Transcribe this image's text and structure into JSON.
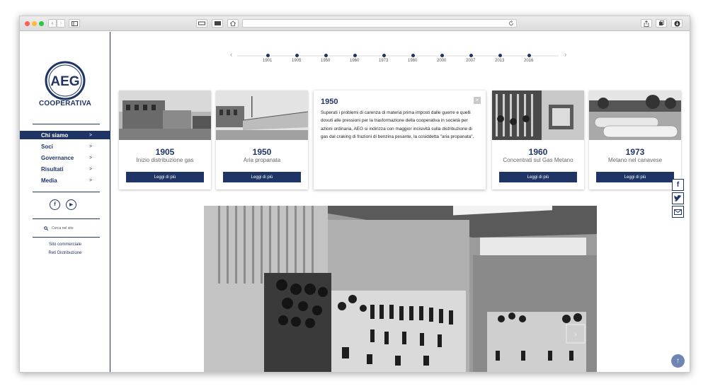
{
  "browser": {
    "back_icon": "chevron-left-icon",
    "forward_icon": "chevron-right-icon",
    "sidebar_icon": "sidebar-icon",
    "reload_icon": "reload-icon",
    "share_icon": "share-icon",
    "tabs_icon": "tabs-icon",
    "download_icon": "download-icon"
  },
  "brand": {
    "logo_text": "AEG",
    "subtitle": "COOPERATIVA",
    "color": "#1f3566"
  },
  "nav": {
    "items": [
      {
        "label": "Chi siamo",
        "chevron": ">",
        "active": true
      },
      {
        "label": "Soci",
        "chevron": ">"
      },
      {
        "label": "Governance",
        "chevron": ">"
      },
      {
        "label": "Risultati",
        "chevron": ">"
      },
      {
        "label": "Media",
        "chevron": ">"
      }
    ]
  },
  "social": {
    "facebook": "f",
    "youtube": "▶"
  },
  "search": {
    "label": "Cerca nel sito"
  },
  "links": [
    "Sito commerciale",
    "Reti Distribuzione"
  ],
  "timeline": {
    "prev": "‹",
    "next": "›",
    "years": [
      "1901",
      "1905",
      "1950",
      "1960",
      "1973",
      "1980",
      "2000",
      "2007",
      "2013",
      "2016"
    ]
  },
  "cards": [
    {
      "year": "1905",
      "caption": "Inizio distribuzione gas",
      "button": "Leggi di più"
    },
    {
      "year": "1950",
      "caption": "Aria propanata",
      "button": "Leggi di più"
    },
    {
      "year": "1960",
      "caption": "Concentrati sul Gas Metano",
      "button": "Leggi di più"
    },
    {
      "year": "1973",
      "caption": "Metano nel canavese",
      "button": "Leggi di più"
    }
  ],
  "expanded": {
    "year": "1950",
    "close": "×",
    "text": "Superati i problemi di carenza di materia prima imposti dalle guerre e quelli dovuti alle pressioni per la trasformazione della cooperativa in società per azioni ordinaria, AEG si indirizza con maggior incisività sulla distribuzione di gas dal craking di frazioni di benzina pesante, la cosiddetta \"aria propanata\"."
  },
  "share": {
    "facebook": "f",
    "twitter": "twitter-icon",
    "email": "email-icon"
  },
  "scroll_top": "↑"
}
